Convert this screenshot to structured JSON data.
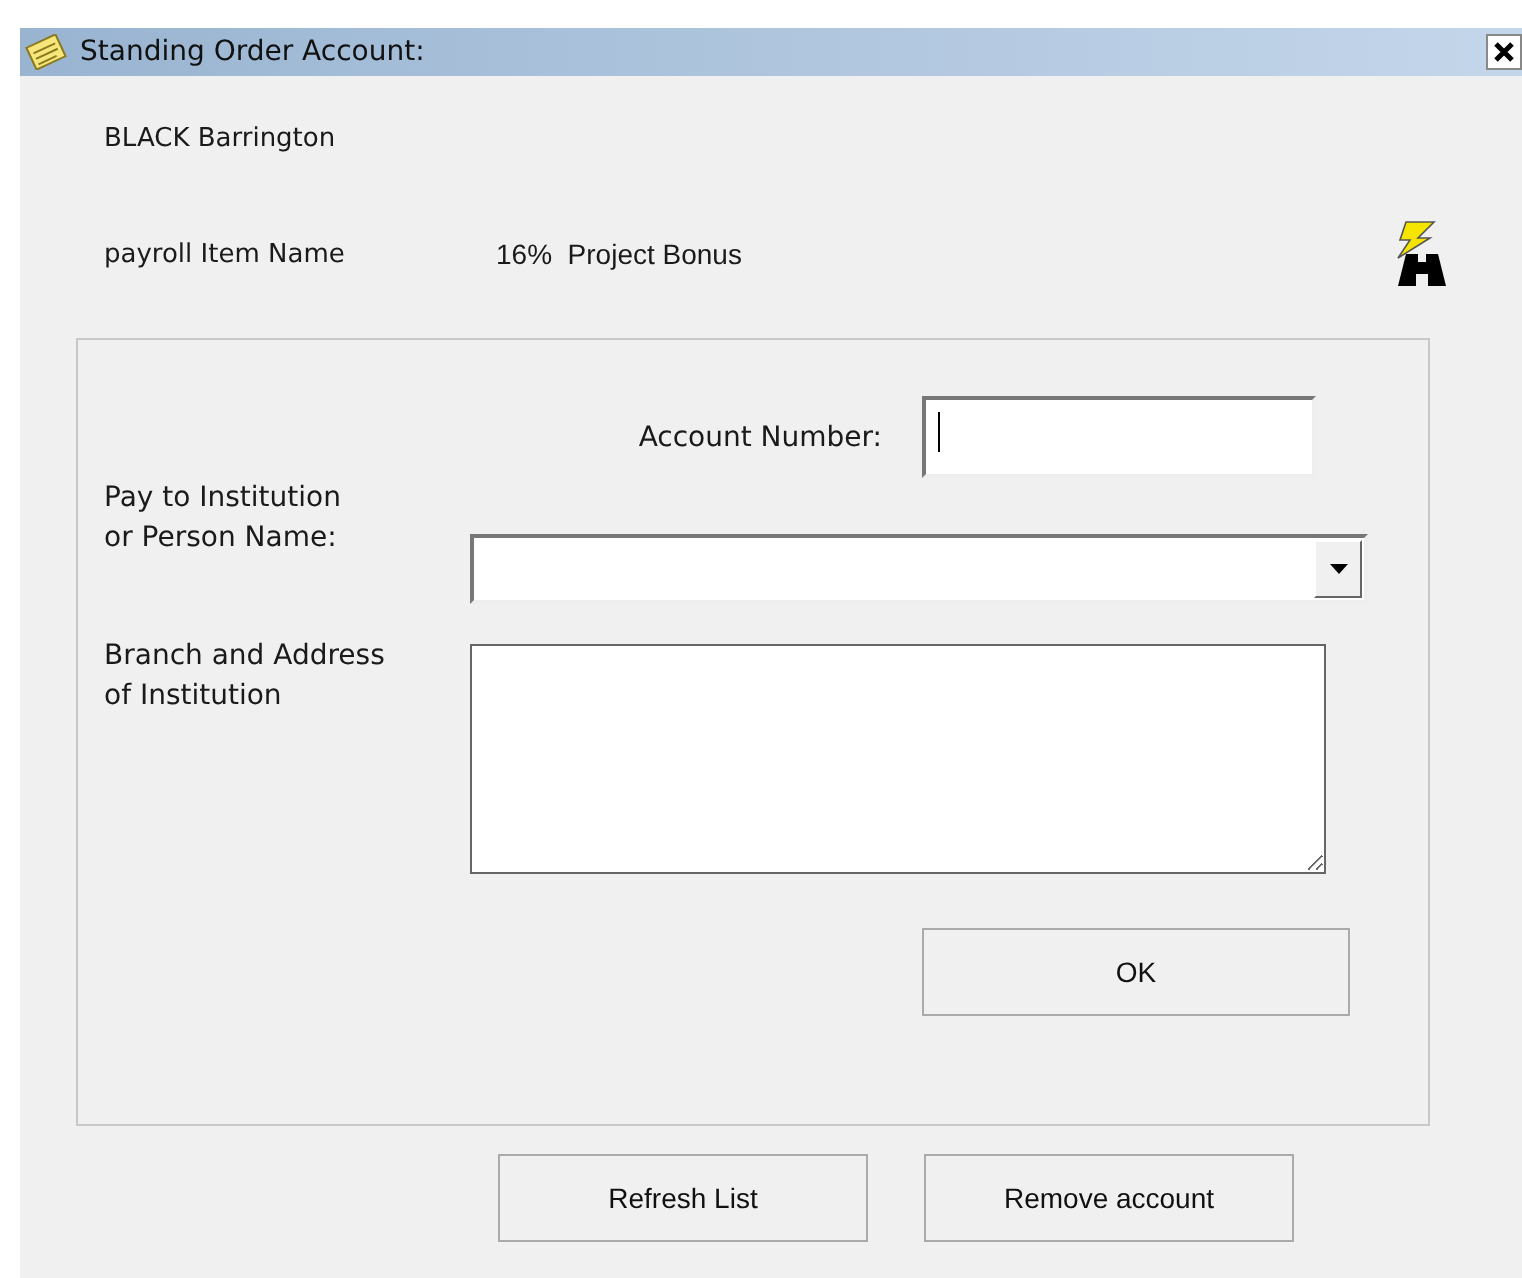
{
  "window": {
    "title": "Standing Order Account:"
  },
  "employee_name": "BLACK Barrington",
  "payroll_item": {
    "label": "payroll Item Name",
    "value": "16%  Project Bonus"
  },
  "form": {
    "account_number": {
      "label": "Account Number:"
    },
    "pay_to": {
      "label_lines": [
        "Pay to Institution",
        "or Person Name:"
      ]
    },
    "branch_address": {
      "label_lines": [
        "Branch and Address",
        "of Institution"
      ]
    },
    "ok_button": "OK"
  },
  "buttons": [
    "Refresh List",
    "Remove account"
  ]
}
